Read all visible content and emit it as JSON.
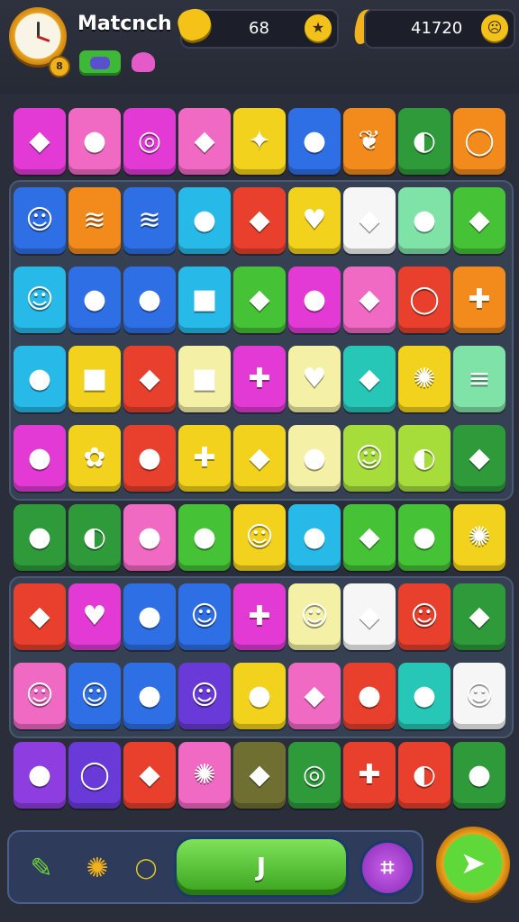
{
  "header": {
    "title": "Matcnch",
    "clock_badge": "8",
    "score_left": "68",
    "score_right": "41720",
    "left_cap_icon": "star-icon",
    "right_cap_icon": "face-icon"
  },
  "colors": {
    "magenta": "#e33ad6",
    "pink": "#f06ac4",
    "purple": "#8e3ee0",
    "violet": "#6a3ad9",
    "blue": "#2f6fe6",
    "cyan": "#27b9e8",
    "teal": "#27c7b7",
    "green": "#45c236",
    "dkgreen": "#2e9a3a",
    "lime": "#a6dd3a",
    "yellow": "#f2d21c",
    "orange": "#f28a1c",
    "red": "#e8402c",
    "cream": "#f4f0a6",
    "white": "#f6f6f6",
    "olive": "#6f6f32",
    "mint": "#7fe3a8"
  },
  "board": {
    "rows": [
      [
        [
          "magenta",
          "◆"
        ],
        [
          "pink",
          "●"
        ],
        [
          "magenta",
          "◎"
        ],
        [
          "pink",
          "◆"
        ],
        [
          "yellow",
          "✦"
        ],
        [
          "blue",
          "●"
        ],
        [
          "orange",
          "❦"
        ],
        [
          "dkgreen",
          "◐"
        ],
        [
          "orange",
          "◯"
        ]
      ],
      [
        [
          "blue",
          "☺"
        ],
        [
          "orange",
          "≋"
        ],
        [
          "blue",
          "≋"
        ],
        [
          "cyan",
          "●"
        ],
        [
          "red",
          "◆"
        ],
        [
          "yellow",
          "♥"
        ],
        [
          "white",
          "◆"
        ],
        [
          "mint",
          "●"
        ],
        [
          "green",
          "◆"
        ]
      ],
      [
        [
          "cyan",
          "☺"
        ],
        [
          "blue",
          "●"
        ],
        [
          "blue",
          "●"
        ],
        [
          "cyan",
          "■"
        ],
        [
          "green",
          "◆"
        ],
        [
          "magenta",
          "●"
        ],
        [
          "pink",
          "◆"
        ],
        [
          "red",
          "◯"
        ],
        [
          "orange",
          "✚"
        ]
      ],
      [
        [
          "cyan",
          "●"
        ],
        [
          "yellow",
          "■"
        ],
        [
          "red",
          "◆"
        ],
        [
          "cream",
          "■"
        ],
        [
          "magenta",
          "✚"
        ],
        [
          "cream",
          "♥"
        ],
        [
          "teal",
          "◆"
        ],
        [
          "yellow",
          "✺"
        ],
        [
          "mint",
          "≡"
        ]
      ],
      [
        [
          "magenta",
          "●"
        ],
        [
          "yellow",
          "✿"
        ],
        [
          "red",
          "●"
        ],
        [
          "yellow",
          "✚"
        ],
        [
          "yellow",
          "◆"
        ],
        [
          "cream",
          "●"
        ],
        [
          "lime",
          "☺"
        ],
        [
          "lime",
          "◐"
        ],
        [
          "dkgreen",
          "◆"
        ]
      ],
      [
        [
          "dkgreen",
          "●"
        ],
        [
          "dkgreen",
          "◐"
        ],
        [
          "pink",
          "●"
        ],
        [
          "green",
          "●"
        ],
        [
          "yellow",
          "☺"
        ],
        [
          "cyan",
          "●"
        ],
        [
          "green",
          "◆"
        ],
        [
          "green",
          "●"
        ],
        [
          "yellow",
          "✺"
        ]
      ],
      [
        [
          "red",
          "◆"
        ],
        [
          "magenta",
          "♥"
        ],
        [
          "blue",
          "●"
        ],
        [
          "blue",
          "☺"
        ],
        [
          "magenta",
          "✚"
        ],
        [
          "cream",
          "☺"
        ],
        [
          "white",
          "◆"
        ],
        [
          "red",
          "☺"
        ],
        [
          "dkgreen",
          "◆"
        ]
      ],
      [
        [
          "pink",
          "☺"
        ],
        [
          "blue",
          "☺"
        ],
        [
          "blue",
          "●"
        ],
        [
          "violet",
          "☺"
        ],
        [
          "yellow",
          "●"
        ],
        [
          "pink",
          "◆"
        ],
        [
          "red",
          "●"
        ],
        [
          "teal",
          "●"
        ],
        [
          "white",
          "☺"
        ]
      ],
      [
        [
          "purple",
          "●"
        ],
        [
          "violet",
          "◯"
        ],
        [
          "red",
          "◆"
        ],
        [
          "pink",
          "✺"
        ],
        [
          "olive",
          "◆"
        ],
        [
          "dkgreen",
          "◎"
        ],
        [
          "red",
          "✚"
        ],
        [
          "red",
          "◐"
        ],
        [
          "dkgreen",
          "●"
        ]
      ]
    ]
  },
  "bottom_bar": {
    "play_label": "J",
    "hash_label": "⌗",
    "go_label": "➤"
  }
}
